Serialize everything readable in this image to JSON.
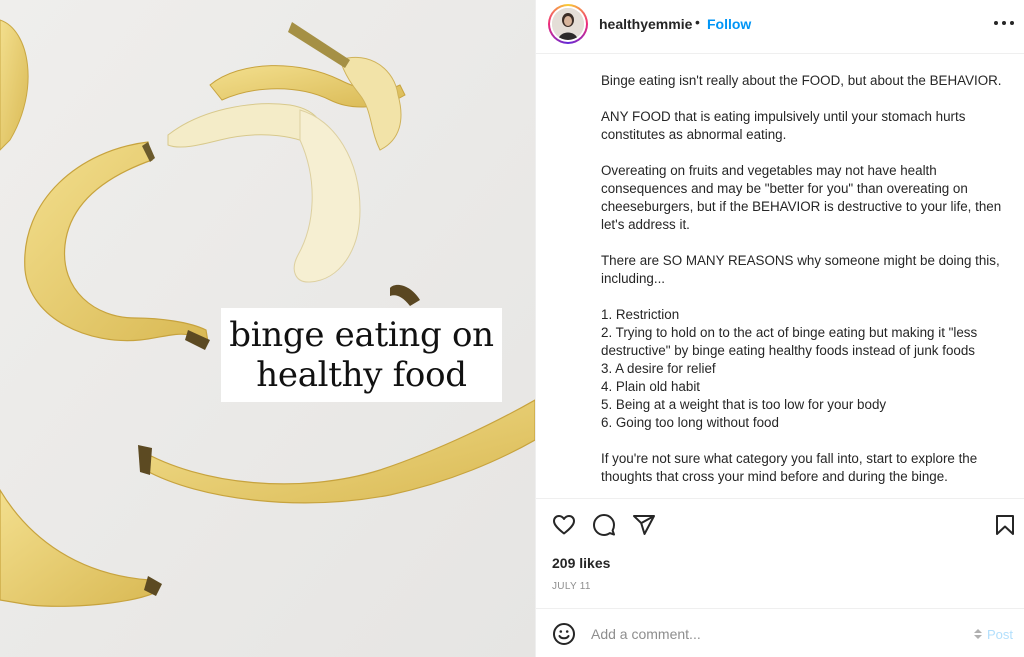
{
  "post": {
    "overlay_text": [
      "binge eating on",
      "healthy food"
    ]
  },
  "header": {
    "username": "healthyemmie",
    "separator": "•",
    "follow_label": "Follow",
    "more_icon": "more-horizontal-icon"
  },
  "caption": {
    "paragraphs": [
      "Binge eating isn't really about the FOOD, but about the BEHAVIOR.",
      "ANY FOOD that is eating impulsively until your stomach hurts constitutes as abnormal eating.",
      "Overeating on fruits and vegetables may not have health consequences and may be \"better for you\" than overeating on cheeseburgers, but if the BEHAVIOR is destructive to your life, then let's address it.",
      "There are SO MANY REASONS why someone might be doing this, including..."
    ],
    "list": [
      "1. Restriction",
      "2. Trying to hold on to the act of binge eating but making it \"less destructive\" by binge eating healthy foods instead of junk foods",
      "3. A desire for relief",
      "4. Plain old habit",
      "5. Being at a weight that is too low for your body",
      "6. Going too long without food"
    ],
    "closing": "If you're not sure what category you fall into, start to explore the thoughts that cross your mind before and during the binge."
  },
  "actions": {
    "like_icon": "heart-icon",
    "comment_icon": "comment-icon",
    "share_icon": "share-icon",
    "save_icon": "bookmark-icon",
    "likes": "209 likes",
    "date": "JULY 11"
  },
  "comment": {
    "emoji_icon": "emoji-icon",
    "placeholder": "Add a comment...",
    "post_label": "Post"
  },
  "colors": {
    "link": "#0095f6",
    "post_disabled": "#b2dffc",
    "text": "#262626",
    "muted": "#8e8e8e",
    "border": "#efefef"
  }
}
